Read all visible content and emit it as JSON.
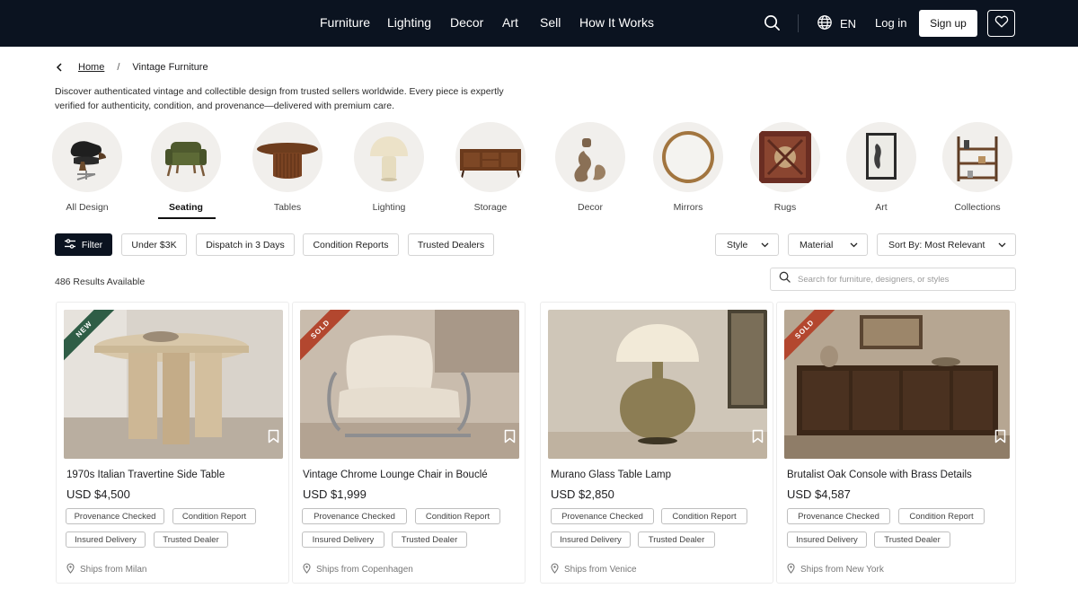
{
  "nav": {
    "links": [
      "Furniture",
      "Lighting",
      "Decor",
      "Art",
      "Sell",
      "How It Works"
    ],
    "lang": "EN",
    "login": "Log in",
    "signup": "Sign up"
  },
  "breadcrumb": {
    "home": "Home",
    "sep": "/",
    "current": "Vintage Furniture"
  },
  "intro": "Discover authenticated vintage and collectible design from trusted sellers worldwide. Every piece is expertly verified for authenticity, condition, and provenance—delivered with premium care.",
  "categories": [
    "All Design",
    "Seating",
    "Tables",
    "Lighting",
    "Storage",
    "Decor",
    "Mirrors",
    "Rugs",
    "Art",
    "Collections"
  ],
  "active_category": "Seating",
  "filters": {
    "filter_label": "Filter",
    "chips": [
      "Under $3K",
      "Dispatch in 3 Days",
      "Condition Reports",
      "Trusted Dealers"
    ],
    "dropdowns": [
      "Style",
      "Material",
      "Sort By: Most Relevant"
    ]
  },
  "results": "486 Results Available",
  "search": {
    "placeholder": "Search for furniture, designers, or styles"
  },
  "products": [
    {
      "ribbon": "NEW",
      "ribbon_color": "#2f5d46",
      "title": "1970s Italian Travertine Side Table",
      "price": "USD $4,500",
      "tags": [
        "Provenance Checked",
        "Condition Report",
        "Insured Delivery",
        "Trusted Dealer"
      ],
      "ships": "Ships from Milan"
    },
    {
      "ribbon": "SOLD",
      "ribbon_color": "#b3472f",
      "title": "Vintage Chrome Lounge Chair in Bouclé",
      "price": "USD $1,999",
      "tags": [
        "Provenance Checked",
        "Condition Report",
        "Insured Delivery",
        "Trusted Dealer"
      ],
      "ships": "Ships from Copenhagen"
    },
    {
      "ribbon": "",
      "ribbon_color": "",
      "title": "Murano Glass Table Lamp",
      "price": "USD $2,850",
      "tags": [
        "Provenance Checked",
        "Condition Report",
        "Insured Delivery",
        "Trusted Dealer"
      ],
      "ships": "Ships from Venice"
    },
    {
      "ribbon": "SOLD",
      "ribbon_color": "#b3472f",
      "title": "Brutalist Oak Console with Brass Details",
      "price": "USD $4,587",
      "tags": [
        "Provenance Checked",
        "Condition Report",
        "Insured Delivery",
        "Trusted Dealer"
      ],
      "ships": "Ships from New York"
    }
  ]
}
